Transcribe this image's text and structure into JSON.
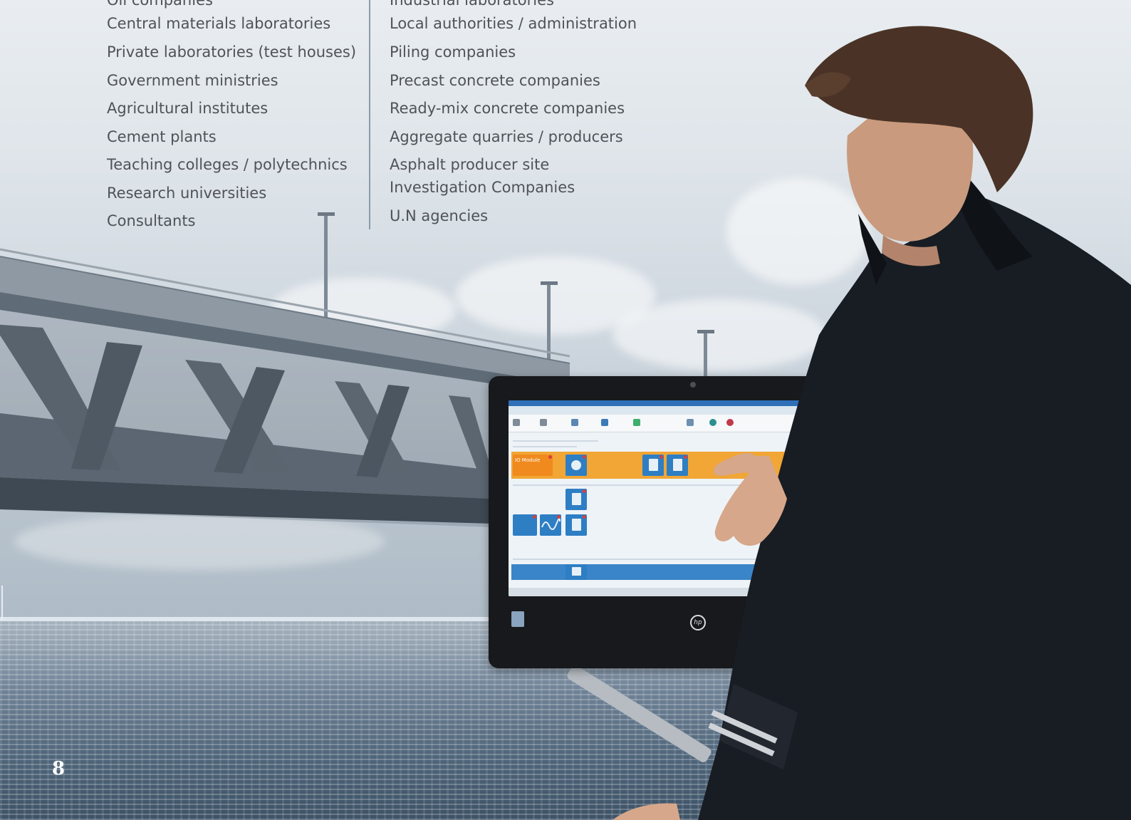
{
  "columns": {
    "left": [
      "Oil companies",
      "Central materials laboratories",
      "Private laboratories (test houses)",
      "Government ministries",
      "Agricultural institutes",
      "Cement plants",
      "Teaching colleges / polytechnics",
      "Research universities",
      "Consultants"
    ],
    "right": [
      "Industrial laboratories",
      "Local authorities / administration",
      "Piling companies",
      "Precast concrete companies",
      "Ready-mix concrete companies",
      "Aggregate quarries / producers",
      "Asphalt producer site",
      "Investigation Companies",
      "U.N agencies"
    ]
  },
  "screen_ui": {
    "tile_label": "IO Module",
    "monitor_brand": "hp"
  },
  "page_number": "8",
  "colors": {
    "text": "#4f5357",
    "divider": "#8a9aa8",
    "screen_accent_orange": "#f1a635",
    "screen_accent_blue": "#2e7ec4",
    "jacket": "#181c23"
  },
  "icons": [
    "document-icon",
    "info-icon",
    "wave-chart-icon",
    "hp-logo",
    "windows-sticker"
  ]
}
